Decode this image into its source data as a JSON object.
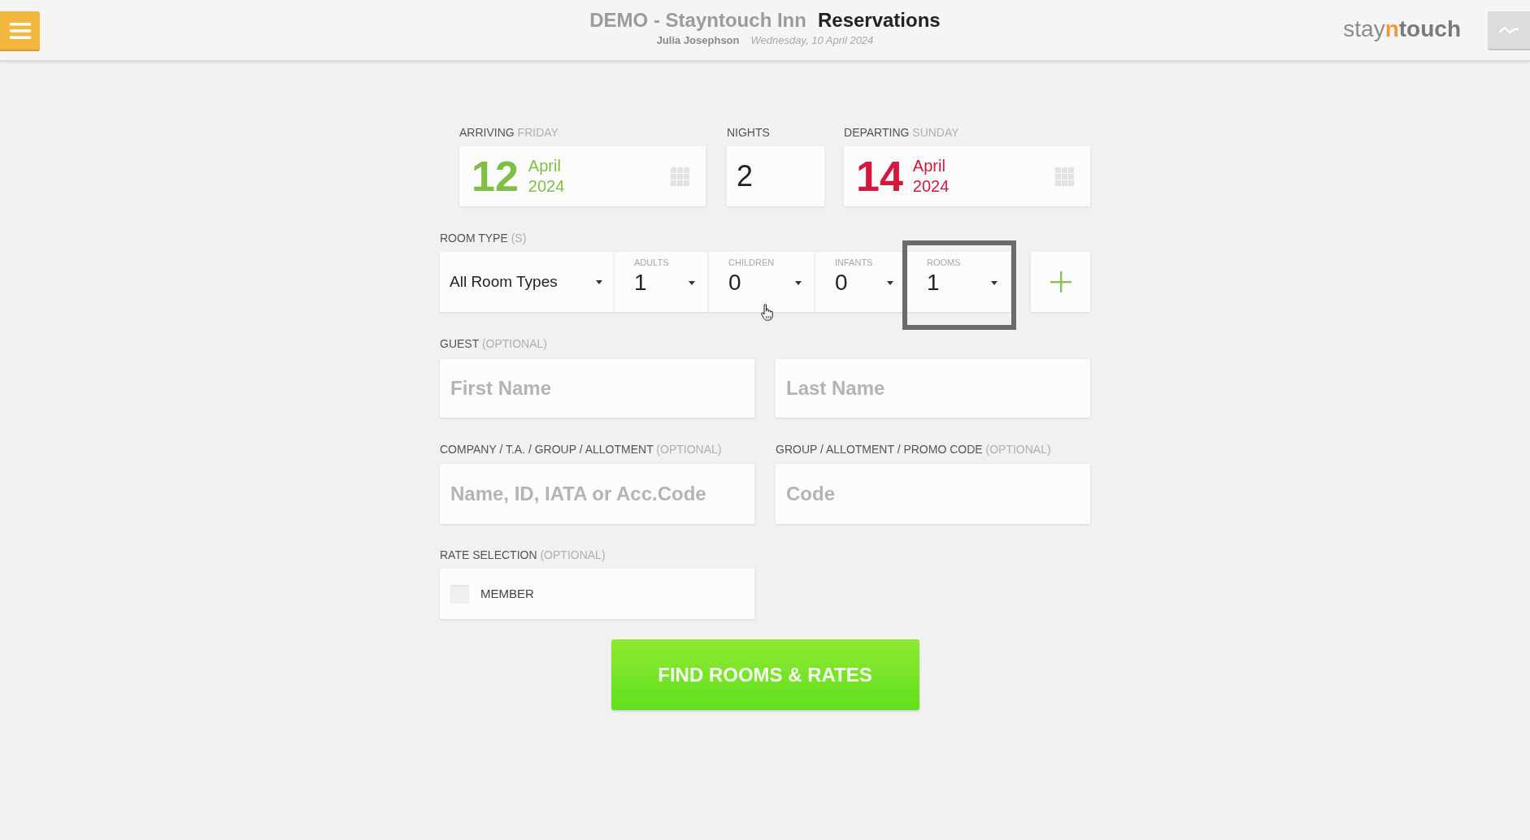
{
  "header": {
    "property": "DEMO - Stayntouch Inn",
    "page_title": "Reservations",
    "user": "Julia Josephson",
    "date": "Wednesday, 10 April 2024",
    "logo": [
      {
        "text": "stay",
        "kind": "light"
      },
      {
        "text": "n",
        "kind": "accent"
      },
      {
        "text": "touch",
        "kind": "bold"
      }
    ]
  },
  "stay": [
    {
      "kind": "date",
      "label": "ARRIVING",
      "qualifier": "FRIDAY",
      "day": "12",
      "month": "April",
      "year": "2024",
      "color": "#7fbf45"
    },
    {
      "kind": "nights",
      "label": "NIGHTS",
      "value": "2"
    },
    {
      "kind": "date",
      "label": "DEPARTING",
      "qualifier": "SUNDAY",
      "day": "14",
      "month": "April",
      "year": "2024",
      "color": "#d3173f"
    }
  ],
  "room_type": {
    "label": "ROOM TYPE",
    "qualifier": "(S)",
    "value": "All Room Types"
  },
  "occupancy": [
    {
      "label": "ADULTS",
      "value": "1",
      "focused": false
    },
    {
      "label": "CHILDREN",
      "value": "0",
      "focused": false
    },
    {
      "label": "INFANTS",
      "value": "0",
      "focused": false
    },
    {
      "label": "ROOMS",
      "value": "1",
      "focused": true
    }
  ],
  "guest": {
    "label": "GUEST",
    "qualifier": "(OPTIONAL)",
    "fields": [
      {
        "placeholder": "First Name"
      },
      {
        "placeholder": "Last Name"
      }
    ]
  },
  "lookups": [
    {
      "label": "COMPANY / T.A. / GROUP / ALLOTMENT",
      "qualifier": "(OPTIONAL)",
      "placeholder": "Name, ID, IATA or Acc.Code"
    },
    {
      "label": "GROUP / ALLOTMENT / PROMO CODE",
      "qualifier": "(OPTIONAL)",
      "placeholder": "Code"
    }
  ],
  "rate_selection": {
    "label": "RATE SELECTION",
    "qualifier": "(OPTIONAL)",
    "options": [
      {
        "label": "MEMBER",
        "checked": false
      }
    ]
  },
  "find_button": "FIND ROOMS & RATES"
}
